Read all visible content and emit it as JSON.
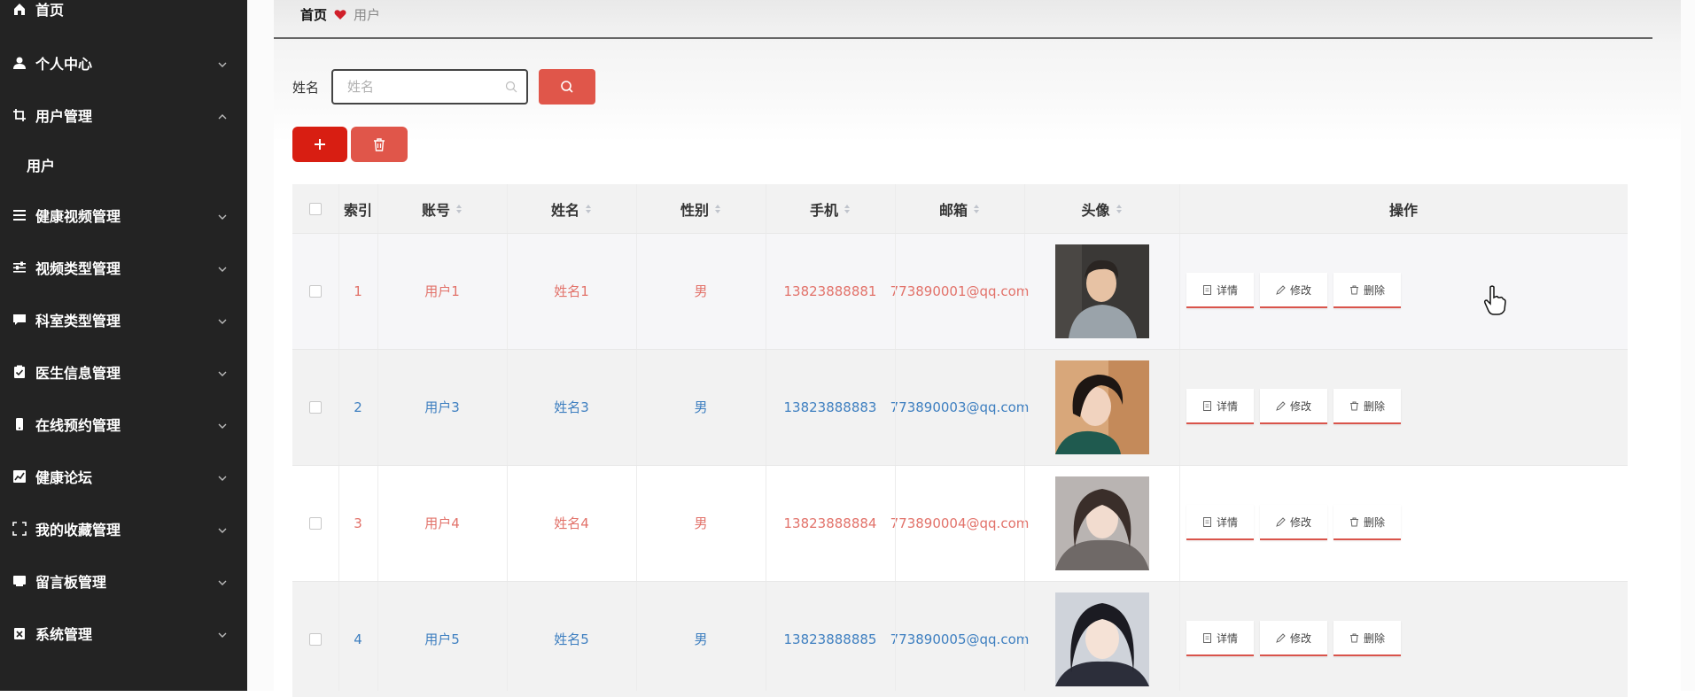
{
  "sidebar": {
    "items": [
      {
        "label": "首页",
        "icon": "home-icon"
      },
      {
        "label": "个人中心",
        "icon": "user-icon"
      },
      {
        "label": "用户管理",
        "icon": "crop-icon"
      },
      {
        "label": "健康视频管理",
        "icon": "list-icon"
      },
      {
        "label": "视频类型管理",
        "icon": "sliders-icon"
      },
      {
        "label": "科室类型管理",
        "icon": "chat-icon"
      },
      {
        "label": "医生信息管理",
        "icon": "clipboard-icon"
      },
      {
        "label": "在线预约管理",
        "icon": "phone-icon"
      },
      {
        "label": "健康论坛",
        "icon": "chart-icon"
      },
      {
        "label": "我的收藏管理",
        "icon": "fullscreen-icon"
      },
      {
        "label": "留言板管理",
        "icon": "message-icon"
      },
      {
        "label": "系统管理",
        "icon": "settings-icon"
      }
    ],
    "submenu": {
      "label": "用户"
    }
  },
  "breadcrumb": {
    "home": "首页",
    "current": "用户"
  },
  "search": {
    "label": "姓名",
    "placeholder": "姓名",
    "value": ""
  },
  "table": {
    "columns": [
      "索引",
      "账号",
      "姓名",
      "性别",
      "手机",
      "邮箱",
      "头像",
      "操作"
    ],
    "rows": [
      {
        "index": "1",
        "account": "用户1",
        "name": "姓名1",
        "gender": "男",
        "phone": "13823888881",
        "email": "773890001@qq.com"
      },
      {
        "index": "2",
        "account": "用户3",
        "name": "姓名3",
        "gender": "男",
        "phone": "13823888883",
        "email": "773890003@qq.com"
      },
      {
        "index": "3",
        "account": "用户4",
        "name": "姓名4",
        "gender": "男",
        "phone": "13823888884",
        "email": "773890004@qq.com"
      },
      {
        "index": "4",
        "account": "用户5",
        "name": "姓名5",
        "gender": "男",
        "phone": "13823888885",
        "email": "773890005@qq.com"
      }
    ],
    "actions": {
      "detail": "详情",
      "edit": "修改",
      "delete": "删除"
    }
  },
  "colors": {
    "sidebar_bg": "#232323",
    "accent_red": "#e0564a",
    "add_red": "#d81e12",
    "text_red": "#e2726a",
    "text_blue": "#3e7fc0"
  }
}
